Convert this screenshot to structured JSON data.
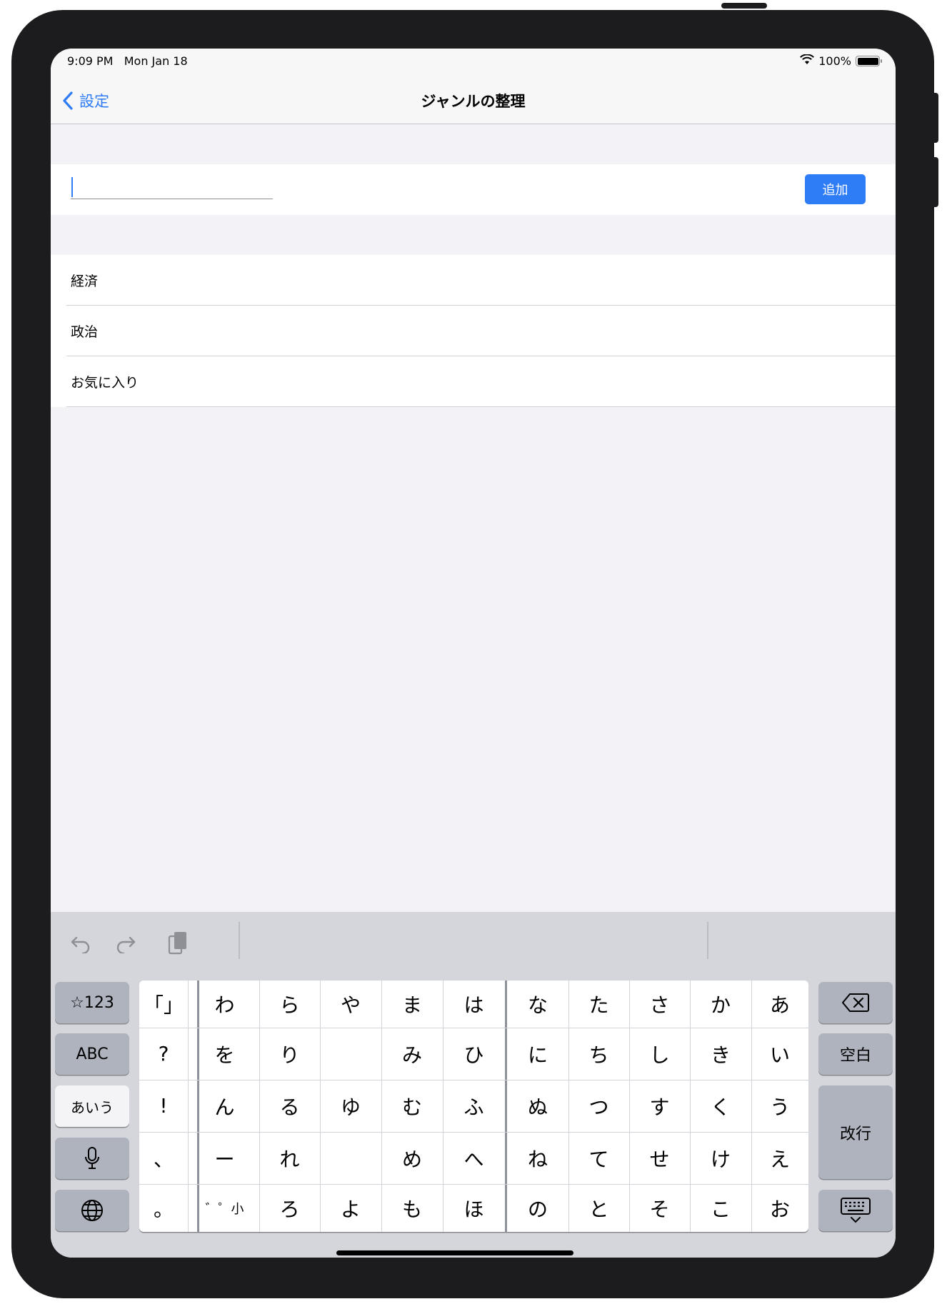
{
  "status_bar": {
    "time": "9:09 PM",
    "date": "Mon Jan 18",
    "battery": "100%",
    "battery_level": 1.0,
    "icons": [
      "wifi-icon",
      "battery-icon"
    ]
  },
  "nav": {
    "back_label": "設定",
    "title": "ジャンルの整理"
  },
  "input": {
    "value": "",
    "placeholder": "",
    "add_button": "追加"
  },
  "genres": [
    "経済",
    "政治",
    "お気に入り"
  ],
  "keyboard": {
    "toolbar_icons": [
      "undo-icon",
      "redo-icon",
      "paste-icon"
    ],
    "left_keys": [
      "☆123",
      "ABC",
      "あいう"
    ],
    "grid": [
      [
        "「」",
        "わ",
        "ら",
        "や",
        "ま",
        "は",
        "な",
        "た",
        "さ",
        "か",
        "あ"
      ],
      [
        "?",
        "を",
        "り",
        "",
        "み",
        "ひ",
        "に",
        "ち",
        "し",
        "き",
        "い"
      ],
      [
        "!",
        "ん",
        "る",
        "ゆ",
        "む",
        "ふ",
        "ぬ",
        "つ",
        "す",
        "く",
        "う"
      ],
      [
        "、",
        "ー",
        "れ",
        "",
        "め",
        "へ",
        "ね",
        "て",
        "せ",
        "け",
        "え"
      ],
      [
        "。",
        "゛゜小",
        "ろ",
        "よ",
        "も",
        "ほ",
        "の",
        "と",
        "そ",
        "こ",
        "お"
      ]
    ],
    "right_keys": {
      "space": "空白",
      "return": "改行"
    }
  },
  "colors": {
    "accent": "#2f7df6",
    "keyboard_bg": "#d4d6db",
    "function_key": "#aeb3be",
    "bezel": "#1c1c1e"
  }
}
